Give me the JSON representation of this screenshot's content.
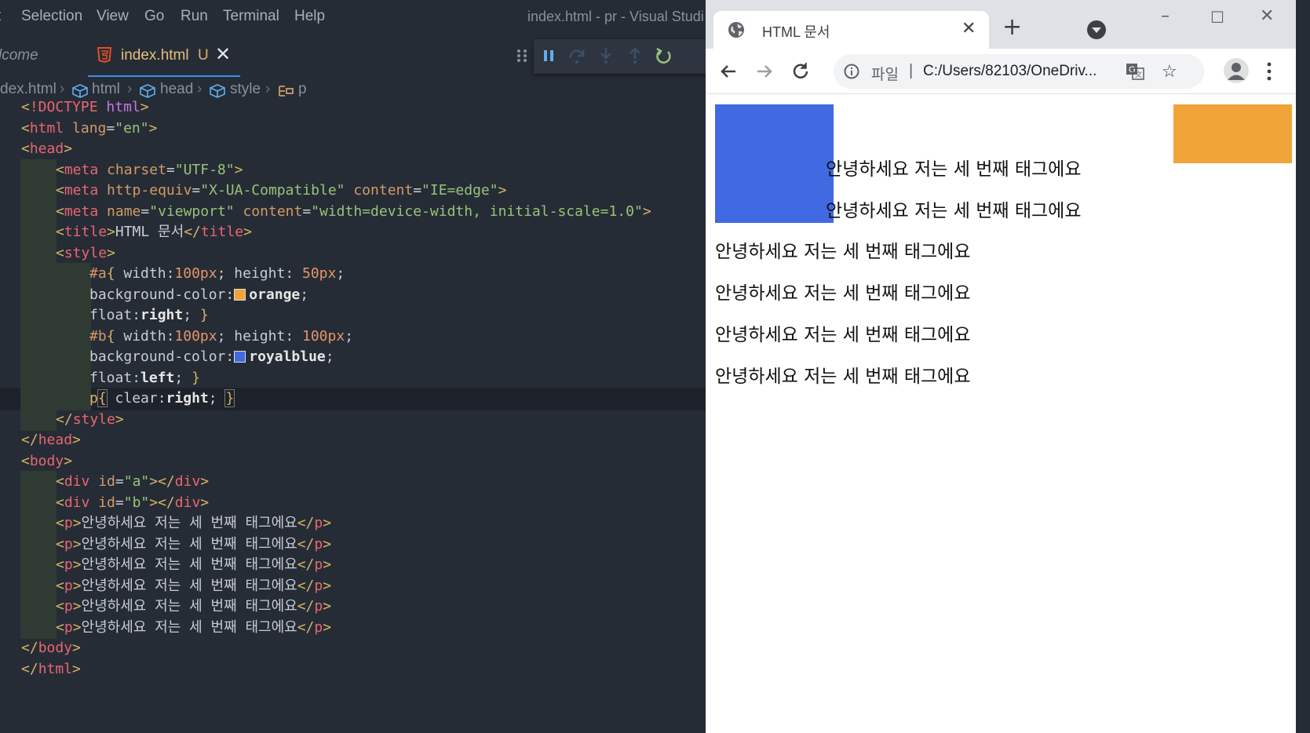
{
  "vscode": {
    "menu": [
      "t",
      "Selection",
      "View",
      "Go",
      "Run",
      "Terminal",
      "Help"
    ],
    "window_title": "index.html - pr - Visual Studi",
    "tabs": {
      "welcome": "lcome",
      "active_file": "index.html",
      "active_status": "U"
    },
    "breadcrumb": [
      "dex.html",
      "html",
      "head",
      "style",
      "p"
    ],
    "code_lines": [
      "<!DOCTYPE html>",
      "<html lang=\"en\">",
      "<head>",
      "<meta charset=\"UTF-8\">",
      "<meta http-equiv=\"X-UA-Compatible\" content=\"IE=edge\">",
      "<meta name=\"viewport\" content=\"width=device-width, initial-scale=1.0\">",
      "<title>HTML 문서</title>",
      "<style>",
      "#a{ width:100px; height: 50px;",
      "background-color: orange;",
      "float:right; }",
      "#b{ width:100px; height: 100px;",
      "background-color: royalblue;",
      "float:left; }",
      "p{ clear:right; }",
      "</style>",
      "</head>",
      "<body>",
      "<div id=\"a\"></div>",
      "<div id=\"b\"></div>",
      "<p>안녕하세요 저는 세 번째 태그에요</p>",
      "<p>안녕하세요 저는 세 번째 태그에요</p>",
      "<p>안녕하세요 저는 세 번째 태그에요</p>",
      "<p>안녕하세요 저는 세 번째 태그에요</p>",
      "<p>안녕하세요 저는 세 번째 태그에요</p>",
      "<p>안녕하세요 저는 세 번째 태그에요</p>",
      "</body>",
      "</html>"
    ],
    "current_line": 15
  },
  "chrome": {
    "tab_title": "HTML 문서",
    "omnibox": {
      "scheme": "파일",
      "divider": "|",
      "url": "C:/Users/82103/OneDriv..."
    },
    "page": {
      "paragraphs": [
        "안녕하세요 저는 세 번째 태그에요",
        "안녕하세요 저는 세 번째 태그에요",
        "안녕하세요 저는 세 번째 태그에요",
        "안녕하세요 저는 세 번째 태그에요",
        "안녕하세요 저는 세 번째 태그에요",
        "안녕하세요 저는 세 번째 태그에요"
      ],
      "box_a_color": "#f0a438",
      "box_b_color": "#4169e1"
    }
  }
}
